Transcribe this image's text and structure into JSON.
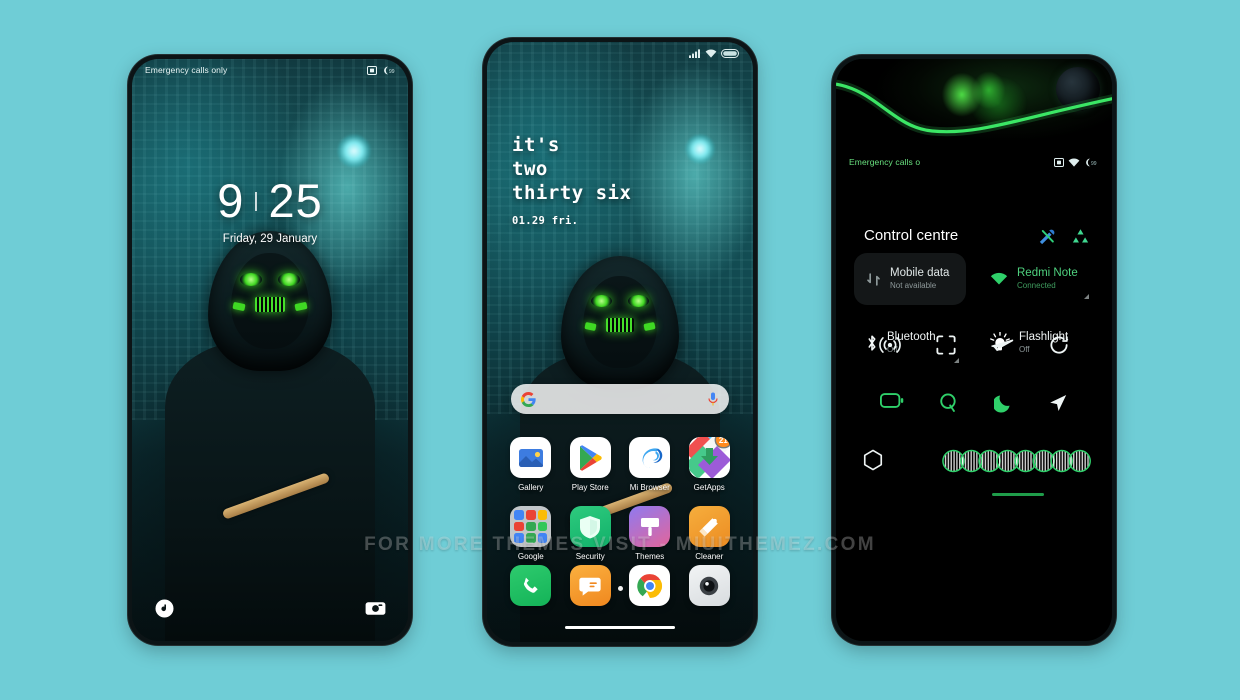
{
  "watermark": "FOR MORE THEMES VISIT - MIUITHEMEZ.COM",
  "theme": {
    "background": "#6fcdd6",
    "accent_green": "#3fd823",
    "panel_black": "#000000"
  },
  "lock_screen": {
    "status_bar": {
      "carrier": "Emergency calls only",
      "icons": [
        "sim-icon",
        "battery-icon"
      ]
    },
    "clock": {
      "hours": "9",
      "separator": "|",
      "minutes": "25"
    },
    "date": "Friday, 29 January",
    "shortcuts": [
      {
        "name": "flashlight-icon",
        "label": "Flashlight"
      },
      {
        "name": "camera-icon",
        "label": "Camera"
      }
    ]
  },
  "home_screen": {
    "status_bar": {
      "carrier": "",
      "icons": [
        "signal-icon",
        "wifi-icon",
        "battery-icon"
      ]
    },
    "widget": {
      "line1": "it's",
      "line2": "two",
      "line3": "thirty six",
      "date": "01.29 fri."
    },
    "search": {
      "placeholder": "",
      "left_icon": "google-g-icon",
      "right_icon": "microphone-icon"
    },
    "apps": [
      {
        "label": "Gallery",
        "icon": "gallery-icon",
        "badge": ""
      },
      {
        "label": "Play Store",
        "icon": "play-store-icon",
        "badge": ""
      },
      {
        "label": "Mi Browser",
        "icon": "mi-browser-icon",
        "badge": ""
      },
      {
        "label": "GetApps",
        "icon": "getapps-icon",
        "badge": "21"
      },
      {
        "label": "Google",
        "icon": "google-folder-icon",
        "badge": ""
      },
      {
        "label": "Security",
        "icon": "security-icon",
        "badge": ""
      },
      {
        "label": "Themes",
        "icon": "themes-icon",
        "badge": ""
      },
      {
        "label": "Cleaner",
        "icon": "cleaner-icon",
        "badge": ""
      }
    ],
    "page_dots": {
      "count": 1,
      "active": 0
    },
    "dock": [
      {
        "label": "Phone",
        "icon": "phone-icon"
      },
      {
        "label": "Messages",
        "icon": "messages-icon"
      },
      {
        "label": "Chrome",
        "icon": "chrome-icon"
      },
      {
        "label": "Camera",
        "icon": "camera-app-icon"
      }
    ]
  },
  "control_centre": {
    "status_bar": {
      "carrier": "Emergency calls o",
      "icons": [
        "sim-icon",
        "wifi-icon",
        "battery-icon"
      ]
    },
    "title": "Control centre",
    "header_actions": [
      {
        "name": "settings-icon",
        "color": "#3f8fe0"
      },
      {
        "name": "edit-toggles-icon",
        "color": "#3fd890"
      }
    ],
    "big_tiles": [
      {
        "name": "Mobile data",
        "status": "Not available",
        "icon": "mobile-data-icon",
        "active": false,
        "has_expand": false
      },
      {
        "name": "Redmi Note",
        "status": "Connected",
        "icon": "wifi-tile-icon",
        "active": true,
        "has_expand": true
      },
      {
        "name": "Bluetooth",
        "status": "Off",
        "icon": "bluetooth-icon",
        "active": false,
        "has_expand": true
      },
      {
        "name": "Flashlight",
        "status": "Off",
        "icon": "flashlight-tile-icon",
        "active": false,
        "has_expand": false
      }
    ],
    "toggles_row1": [
      {
        "name": "hotspot-icon",
        "on": false
      },
      {
        "name": "screenshot-icon",
        "on": false
      },
      {
        "name": "airplane-mode-icon",
        "on": false
      },
      {
        "name": "sync-icon",
        "on": false
      }
    ],
    "toggles_row2": [
      {
        "name": "battery-saver-icon",
        "on": true
      },
      {
        "name": "quiet-mode-icon",
        "on": true
      },
      {
        "name": "dark-mode-icon",
        "on": true
      },
      {
        "name": "location-icon",
        "on": false
      }
    ],
    "toggles_row3": [
      {
        "name": "do-not-disturb-icon",
        "on": false
      }
    ],
    "brightness_slider": {
      "name": "brightness-slider",
      "style": "dna-helix",
      "value": 50
    }
  }
}
